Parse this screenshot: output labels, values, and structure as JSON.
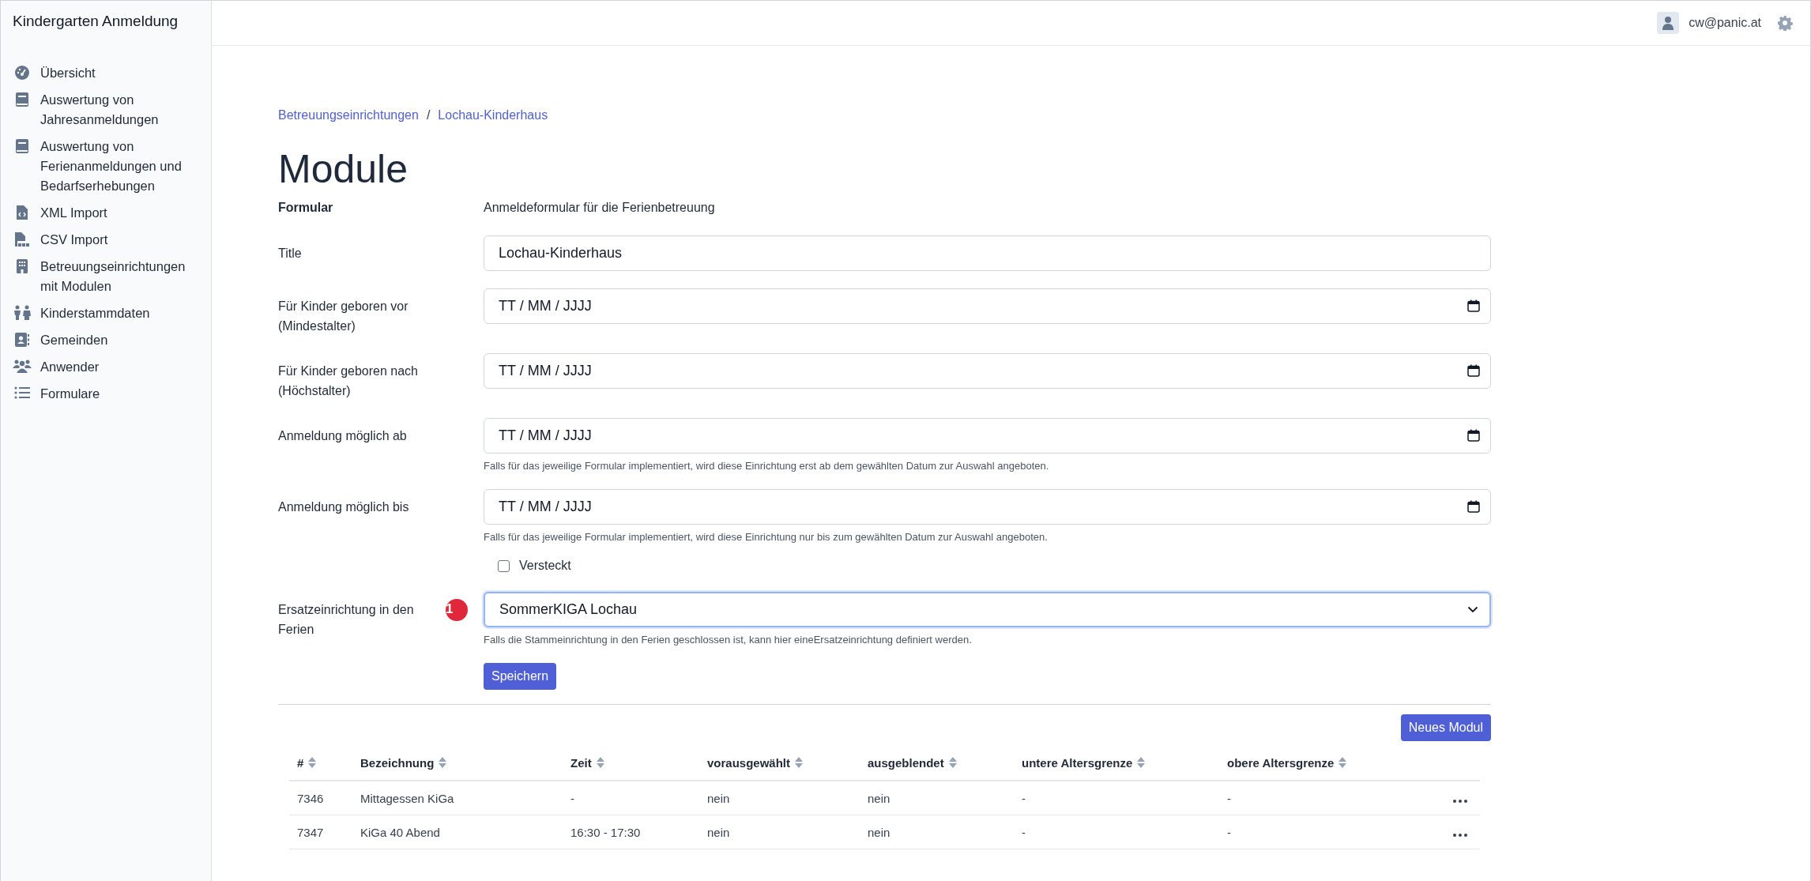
{
  "app_title": "Kindergarten Anmeldung",
  "sidebar": {
    "items": [
      {
        "label": "Übersicht"
      },
      {
        "label": "Auswertung von Jahresanmeldungen"
      },
      {
        "label": "Auswertung von Ferienanmeldungen und Bedarfserhebungen"
      },
      {
        "label": "XML Import"
      },
      {
        "label": "CSV Import"
      },
      {
        "label": "Betreuungseinrichtungen mit Modulen"
      },
      {
        "label": "Kinderstammdaten"
      },
      {
        "label": "Gemeinden"
      },
      {
        "label": "Anwender"
      },
      {
        "label": "Formulare"
      }
    ]
  },
  "user": {
    "email": "cw@panic.at"
  },
  "breadcrumb": [
    "Betreuungseinrichtungen",
    "Lochau-Kinderhaus"
  ],
  "breadcrumb_separator": "/",
  "heading": "Module",
  "form": {
    "formular_label": "Formular",
    "formular_value": "Anmeldeformular für die Ferienbetreuung",
    "fields": [
      {
        "kind": "text",
        "label": "Title",
        "value": "Lochau-Kinderhaus"
      },
      {
        "kind": "date",
        "label": "Für Kinder geboren vor (Mindestalter)",
        "placeholder": "TT / MM / JJJJ"
      },
      {
        "kind": "date",
        "label": "Für Kinder geboren nach (Höchstalter)",
        "placeholder": "TT / MM / JJJJ"
      },
      {
        "kind": "date",
        "label": "Anmeldung möglich ab",
        "placeholder": "TT / MM / JJJJ",
        "help": "Falls für das jeweilige Formular implementiert, wird diese Einrichtung erst ab dem gewählten Datum zur Auswahl angeboten."
      },
      {
        "kind": "date",
        "label": "Anmeldung möglich bis",
        "placeholder": "TT / MM / JJJJ",
        "help": "Falls für das jeweilige Formular implementiert, wird diese Einrichtung nur bis zum gewählten Datum zur Auswahl angeboten."
      },
      {
        "kind": "checkbox",
        "label": "Versteckt",
        "checked": false
      },
      {
        "kind": "select",
        "label": "Ersatzeinrichtung in den Ferien",
        "value": "SommerKIGA Lochau",
        "badge": "1",
        "focused": true,
        "help": "Falls die Stammeinrichtung in den Ferien geschlossen ist, kann hier eineErsatzeinrichtung definiert werden."
      }
    ],
    "submit": "Speichern"
  },
  "table": {
    "new_button": "Neues Modul",
    "columns": [
      "#",
      "Bezeichnung",
      "Zeit",
      "vorausgewählt",
      "ausgeblendet",
      "untere Altersgrenze",
      "obere Altersgrenze"
    ],
    "rows": [
      {
        "cells": [
          "7346",
          "Mittagessen KiGa",
          "-",
          "nein",
          "nein",
          "-",
          "-"
        ]
      },
      {
        "cells": [
          "7347",
          "KiGa 40 Abend",
          "16:30 - 17:30",
          "nein",
          "nein",
          "-",
          "-"
        ]
      }
    ]
  }
}
